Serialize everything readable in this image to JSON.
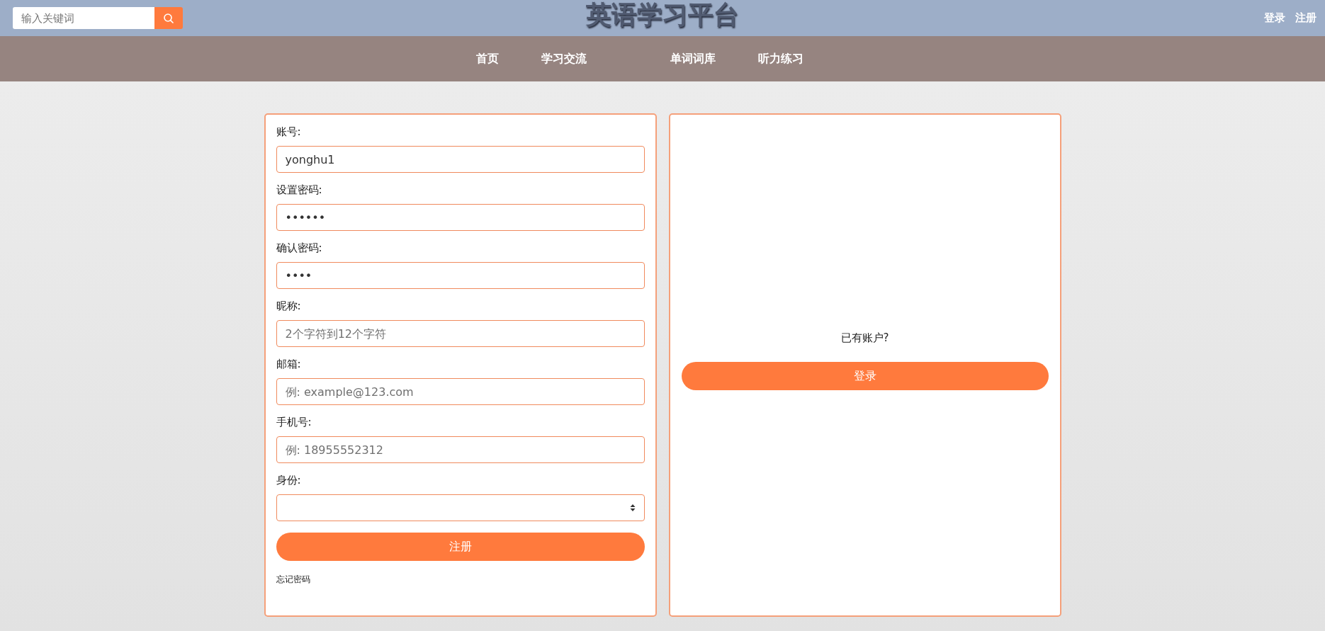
{
  "header": {
    "search": {
      "placeholder": "输入关键词"
    },
    "title": "英语学习平台",
    "links": [
      "登录",
      "注册"
    ]
  },
  "nav": [
    "首页",
    "学习交流",
    "单词词库",
    "听力练习"
  ],
  "register_form": {
    "fields": [
      {
        "kind": "input",
        "label": "账号:",
        "value": "yonghu1"
      },
      {
        "kind": "input",
        "label": "设置密码:",
        "value": "••••••"
      },
      {
        "kind": "input",
        "label": "确认密码:",
        "value": "••••"
      },
      {
        "kind": "input",
        "label": "昵称:",
        "placeholder": "2个字符到12个字符"
      },
      {
        "kind": "input",
        "label": "邮箱:",
        "placeholder": "例: example@123.com"
      },
      {
        "kind": "input",
        "label": "手机号:",
        "placeholder": "例: 18955552312"
      },
      {
        "kind": "select",
        "label": "身份:"
      }
    ],
    "submit": "注册",
    "forgot_link": "忘记密码"
  },
  "login_panel": {
    "prompt": "已有账户?",
    "button": "登录"
  }
}
